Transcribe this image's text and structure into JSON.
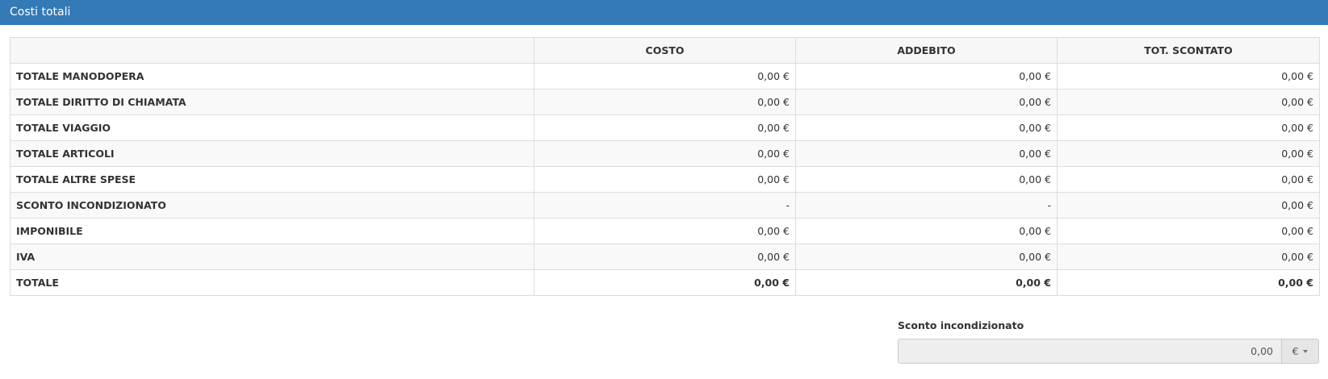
{
  "header": {
    "title": "Costi totali"
  },
  "table": {
    "columns": [
      "",
      "COSTO",
      "ADDEBITO",
      "TOT. SCONTATO"
    ],
    "rows": [
      {
        "label": "TOTALE MANODOPERA",
        "costo": "0,00 €",
        "addebito": "0,00 €",
        "scontato": "0,00 €"
      },
      {
        "label": "TOTALE DIRITTO DI CHIAMATA",
        "costo": "0,00 €",
        "addebito": "0,00 €",
        "scontato": "0,00 €"
      },
      {
        "label": "TOTALE VIAGGIO",
        "costo": "0,00 €",
        "addebito": "0,00 €",
        "scontato": "0,00 €"
      },
      {
        "label": "TOTALE ARTICOLI",
        "costo": "0,00 €",
        "addebito": "0,00 €",
        "scontato": "0,00 €"
      },
      {
        "label": "TOTALE ALTRE SPESE",
        "costo": "0,00 €",
        "addebito": "0,00 €",
        "scontato": "0,00 €"
      },
      {
        "label": "SCONTO INCONDIZIONATO",
        "costo": "-",
        "addebito": "-",
        "scontato": "0,00 €"
      },
      {
        "label": "IMPONIBILE",
        "costo": "0,00 €",
        "addebito": "0,00 €",
        "scontato": "0,00 €"
      },
      {
        "label": "IVA",
        "costo": "0,00 €",
        "addebito": "0,00 €",
        "scontato": "0,00 €"
      },
      {
        "label": "TOTALE",
        "costo": "0,00 €",
        "addebito": "0,00 €",
        "scontato": "0,00 €"
      }
    ]
  },
  "discount": {
    "label": "Sconto incondizionato",
    "value": "0,00",
    "currency": "€",
    "currency_icon": "caret-down-icon"
  }
}
